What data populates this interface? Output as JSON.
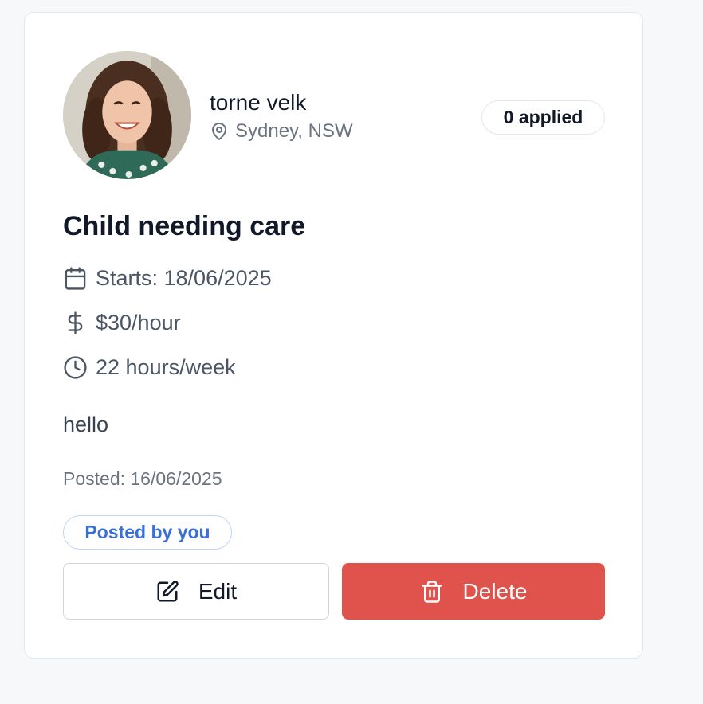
{
  "job_card": {
    "poster": {
      "name": "torne velk",
      "location": "Sydney, NSW",
      "avatar_alt": "Profile photo"
    },
    "applied_count": "0 applied",
    "title": "Child needing care",
    "details": {
      "start": "Starts: 18/06/2025",
      "rate": "$30/hour",
      "hours": "22 hours/week"
    },
    "description": "hello",
    "posted": "Posted: 16/06/2025",
    "owner_badge": "Posted by you",
    "actions": {
      "edit_label": "Edit",
      "delete_label": "Delete"
    }
  },
  "icons": {
    "location": "map-pin-icon",
    "start": "calendar-icon",
    "rate": "dollar-sign-icon",
    "hours": "clock-icon",
    "edit": "edit-icon",
    "delete": "trash-icon"
  },
  "colors": {
    "delete_button": "#df534c",
    "badge_accent": "#3b6fd8",
    "text_primary": "#111827",
    "text_muted": "#6b7280"
  }
}
